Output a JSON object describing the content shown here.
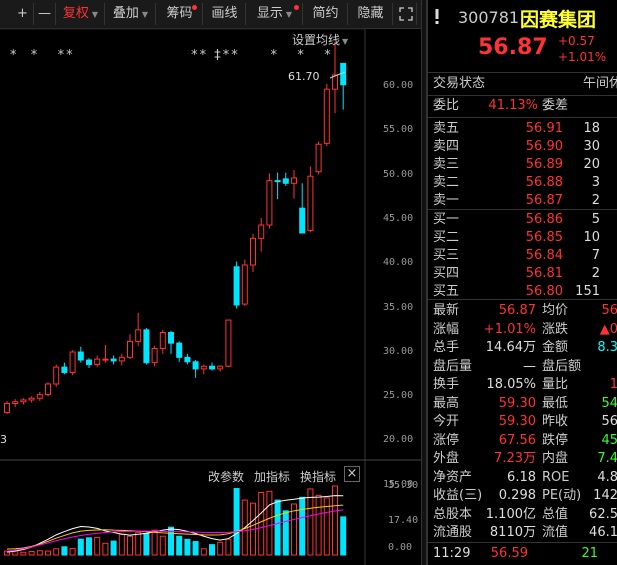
{
  "toolbar": {
    "plus": "+",
    "minus": "—",
    "adjust": "复权",
    "overlay": "叠加",
    "chips": "筹码",
    "draw": "画线",
    "display": "显示",
    "simple": "简约",
    "hide": "隐藏"
  },
  "chart": {
    "ma_setting": "设置均线",
    "max_label": "61.70",
    "low_label": "3",
    "stars": "*  *   **                   ** ‡**     *   *   *",
    "y_ticks": [
      "60.00",
      "55.00",
      "50.00",
      "45.00",
      "40.00",
      "35.00",
      "30.00",
      "25.00",
      "20.00",
      "15.00"
    ],
    "vol_buttons": [
      "改参数",
      "加指标",
      "换指标"
    ],
    "vol_close": "×",
    "vol_ticks": [
      "35.30",
      "17.40",
      "0.00"
    ],
    "colors": {
      "up": "#ff3333",
      "down": "#00e5ff",
      "ma1": "#ffffff",
      "ma2": "#ffcc00",
      "ma3": "#ff00ff"
    }
  },
  "chart_data": {
    "type": "candlestick",
    "ylim": [
      12.5,
      62.5
    ],
    "candles": [
      [
        20.0,
        21.3,
        19.8,
        21.0
      ],
      [
        21.0,
        21.5,
        20.6,
        21.2
      ],
      [
        21.2,
        21.6,
        20.9,
        21.4
      ],
      [
        21.4,
        21.8,
        21.1,
        21.6
      ],
      [
        21.6,
        22.3,
        21.3,
        22.0
      ],
      [
        22.0,
        23.4,
        21.8,
        23.2
      ],
      [
        23.2,
        25.4,
        22.9,
        25.1
      ],
      [
        25.1,
        25.6,
        24.3,
        24.5
      ],
      [
        24.5,
        27.0,
        24.2,
        26.8
      ],
      [
        26.8,
        27.4,
        25.6,
        25.9
      ],
      [
        25.9,
        26.1,
        25.0,
        25.4
      ],
      [
        25.4,
        26.4,
        25.1,
        26.0
      ],
      [
        26.0,
        27.6,
        25.6,
        26.0
      ],
      [
        26.0,
        26.4,
        25.4,
        25.8
      ],
      [
        25.8,
        26.6,
        25.3,
        26.2
      ],
      [
        26.2,
        28.8,
        26.0,
        28.0
      ],
      [
        28.0,
        31.2,
        27.5,
        29.3
      ],
      [
        29.3,
        29.5,
        25.4,
        25.6
      ],
      [
        25.6,
        27.5,
        25.2,
        27.2
      ],
      [
        27.2,
        29.3,
        26.6,
        29.0
      ],
      [
        29.0,
        29.2,
        26.6,
        27.8
      ],
      [
        27.8,
        28.0,
        25.7,
        26.2
      ],
      [
        26.2,
        26.6,
        25.4,
        25.7
      ],
      [
        25.7,
        25.9,
        23.9,
        24.9
      ],
      [
        24.9,
        25.4,
        24.3,
        25.2
      ],
      [
        25.2,
        25.6,
        24.7,
        24.9
      ],
      [
        24.9,
        25.3,
        24.6,
        25.2
      ],
      [
        25.2,
        30.4,
        25.1,
        30.4
      ],
      [
        36.4,
        37.0,
        31.7,
        32.1
      ],
      [
        32.2,
        37.2,
        32.0,
        36.6
      ],
      [
        36.6,
        40.1,
        35.8,
        39.6
      ],
      [
        39.6,
        41.9,
        38.1,
        41.1
      ],
      [
        41.1,
        46.9,
        40.7,
        46.1
      ],
      [
        46.1,
        47.0,
        44.0,
        46.0
      ],
      [
        46.3,
        47.0,
        45.5,
        45.8
      ],
      [
        45.8,
        47.3,
        44.1,
        46.4
      ],
      [
        43.0,
        45.8,
        40.7,
        40.2
      ],
      [
        40.5,
        47.7,
        40.3,
        46.6
      ],
      [
        47.1,
        50.5,
        46.8,
        50.2
      ],
      [
        50.3,
        57.0,
        50.0,
        56.4
      ],
      [
        56.4,
        61.7,
        53.7,
        58.0
      ],
      [
        59.3,
        59.3,
        54.1,
        56.9
      ]
    ],
    "volumes": [
      2.0,
      2.3,
      1.4,
      1.8,
      2.2,
      2.0,
      3.2,
      4.2,
      3.3,
      8.1,
      8.8,
      9.0,
      6.0,
      7.1,
      10.6,
      9.6,
      11.6,
      11.0,
      12.7,
      9.6,
      14.2,
      9.6,
      8.0,
      6.9,
      3.2,
      5.3,
      6.5,
      8.1,
      34.0,
      28.1,
      26.5,
      32.0,
      32.6,
      28.1,
      22.6,
      26.1,
      29.5,
      33.8,
      30.5,
      29.2,
      35.3,
      19.5
    ],
    "ma_lines": {
      "ma1": [
        1.5,
        2.0,
        2.8,
        4.0,
        6.0,
        8.0,
        10.3,
        12.0,
        13.5,
        14.6,
        14.3,
        13.6,
        12.3,
        11.5,
        10.7,
        10.2,
        10.6,
        11.1,
        11.8,
        12.7,
        13.3,
        13.0,
        12.1,
        11.0,
        9.6,
        8.4,
        7.6,
        8.4,
        11.0,
        14.0,
        17.6,
        21.5,
        25.6,
        27.3,
        28.0,
        28.5,
        29.1,
        29.5,
        29.6,
        29.9,
        30.4,
        30.3
      ],
      "ma2": [
        3.0,
        3.2,
        3.6,
        4.4,
        5.6,
        7.0,
        8.6,
        10.0,
        11.3,
        12.2,
        12.6,
        12.8,
        12.9,
        12.7,
        12.6,
        12.4,
        12.2,
        11.9,
        11.6,
        11.3,
        11.1,
        10.9,
        10.7,
        10.5,
        10.3,
        10.2,
        10.3,
        10.9,
        12.0,
        13.5,
        15.2,
        17.0,
        18.8,
        20.3,
        21.6,
        22.6,
        23.3,
        23.9,
        24.4,
        24.8,
        25.2,
        25.5
      ],
      "ma3": [
        2.0,
        2.5,
        3.2,
        4.1,
        5.1,
        6.2,
        7.3,
        8.3,
        9.2,
        10.0,
        10.6,
        11.1,
        11.5,
        11.8,
        12.0,
        12.1,
        12.2,
        12.2,
        12.2,
        12.1,
        12.0,
        11.9,
        11.8,
        11.7,
        11.6,
        11.5,
        11.5,
        11.6,
        11.9,
        12.4,
        13.1,
        14.0,
        15.0,
        16.1,
        17.2,
        18.2,
        19.2,
        20.1,
        21.0,
        21.8,
        22.5,
        23.1
      ]
    }
  },
  "quote": {
    "code": "300781",
    "name": "因赛集团",
    "price": "56.87",
    "change": "+0.57",
    "pct": "+1.01%",
    "status_label": "交易状态",
    "status_value": "午间休",
    "weibi_label": "委比",
    "weibi_value": "41.13%",
    "weicha_label": "委差",
    "asks": [
      {
        "label": "卖五",
        "price": "56.91",
        "vol": "18"
      },
      {
        "label": "卖四",
        "price": "56.90",
        "vol": "30"
      },
      {
        "label": "卖三",
        "price": "56.89",
        "vol": "20"
      },
      {
        "label": "卖二",
        "price": "56.88",
        "vol": "3"
      },
      {
        "label": "卖一",
        "price": "56.87",
        "vol": "2"
      }
    ],
    "bids": [
      {
        "label": "买一",
        "price": "56.86",
        "vol": "5"
      },
      {
        "label": "买二",
        "price": "56.85",
        "vol": "10"
      },
      {
        "label": "买三",
        "price": "56.84",
        "vol": "7"
      },
      {
        "label": "买四",
        "price": "56.81",
        "vol": "2"
      },
      {
        "label": "买五",
        "price": "56.80",
        "vol": "151"
      }
    ],
    "stats": [
      {
        "l1": "最新",
        "v1": "56.87",
        "c1": "red",
        "l2": "均价",
        "v2": "56",
        "c2": "red"
      },
      {
        "l1": "涨幅",
        "v1": "+1.01%",
        "c1": "red",
        "l2": "涨跌",
        "v2": "▲0",
        "c2": "red"
      },
      {
        "l1": "总手",
        "v1": "14.64万",
        "c1": "white",
        "l2": "金额",
        "v2": "8.3",
        "c2": "cyan"
      },
      {
        "l1": "盘后量",
        "v1": "—",
        "c1": "white",
        "l2": "盘后额",
        "v2": "",
        "c2": "white"
      },
      {
        "l1": "换手",
        "v1": "18.05%",
        "c1": "white",
        "l2": "量比",
        "v2": "1",
        "c2": "red"
      },
      {
        "l1": "最高",
        "v1": "59.30",
        "c1": "red",
        "l2": "最低",
        "v2": "54",
        "c2": "green"
      },
      {
        "l1": "今开",
        "v1": "59.30",
        "c1": "red",
        "l2": "昨收",
        "v2": "56",
        "c2": "white"
      },
      {
        "l1": "涨停",
        "v1": "67.56",
        "c1": "red",
        "l2": "跌停",
        "v2": "45",
        "c2": "green"
      },
      {
        "l1": "外盘",
        "v1": "7.23万",
        "c1": "red",
        "l2": "内盘",
        "v2": "7.4",
        "c2": "green"
      },
      {
        "l1": "净资产",
        "v1": "6.18",
        "c1": "white",
        "l2": "ROE",
        "v2": "4.8",
        "c2": "white"
      },
      {
        "l1": "收益(三)",
        "v1": "0.298",
        "c1": "white",
        "l2": "PE(动)",
        "v2": "142",
        "c2": "white"
      },
      {
        "l1": "总股本",
        "v1": "1.100亿",
        "c1": "white",
        "l2": "总值",
        "v2": "62.5",
        "c2": "white"
      },
      {
        "l1": "流通股",
        "v1": "8110万",
        "c1": "white",
        "l2": "流值",
        "v2": "46.1",
        "c2": "white"
      }
    ],
    "tick": {
      "time": "11:29",
      "price": "56.59",
      "vol": "21"
    }
  }
}
